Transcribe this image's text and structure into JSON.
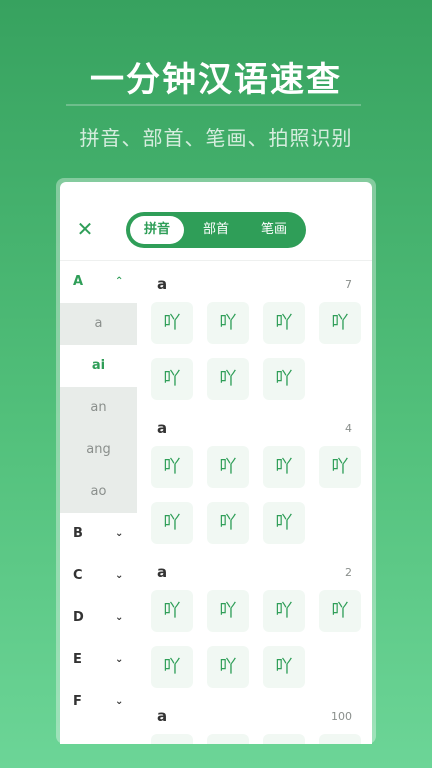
{
  "hero": {
    "title": "一分钟汉语速查",
    "subtitle": "拼音、部首、笔画、拍照识别"
  },
  "header": {
    "close_icon": "✕",
    "tabs": [
      {
        "label": "拼音",
        "active": true
      },
      {
        "label": "部首",
        "active": false
      },
      {
        "label": "笔画",
        "active": false
      }
    ]
  },
  "index": {
    "groups": [
      {
        "letter": "A",
        "expanded": true,
        "chevron": "⌃"
      },
      {
        "letter": "B",
        "expanded": false,
        "chevron": "⌄"
      },
      {
        "letter": "C",
        "expanded": false,
        "chevron": "⌄"
      },
      {
        "letter": "D",
        "expanded": false,
        "chevron": "⌄"
      },
      {
        "letter": "E",
        "expanded": false,
        "chevron": "⌄"
      },
      {
        "letter": "F",
        "expanded": false,
        "chevron": "⌄"
      }
    ],
    "sub_items": [
      "a",
      "ai",
      "an",
      "ang",
      "ao"
    ],
    "active_sub": "ai"
  },
  "sections": [
    {
      "title": "a",
      "count": "7",
      "chars": [
        "吖",
        "吖",
        "吖",
        "吖",
        "吖",
        "吖",
        "吖"
      ]
    },
    {
      "title": "a",
      "count": "4",
      "chars": [
        "吖",
        "吖",
        "吖",
        "吖",
        "吖",
        "吖",
        "吖"
      ]
    },
    {
      "title": "a",
      "count": "2",
      "chars": [
        "吖",
        "吖",
        "吖",
        "吖",
        "吖",
        "吖",
        "吖"
      ]
    },
    {
      "title": "a",
      "count": "100",
      "chars": []
    }
  ],
  "colors": {
    "accent": "#2f9e58",
    "cell_bg": "#f1f8f3"
  }
}
